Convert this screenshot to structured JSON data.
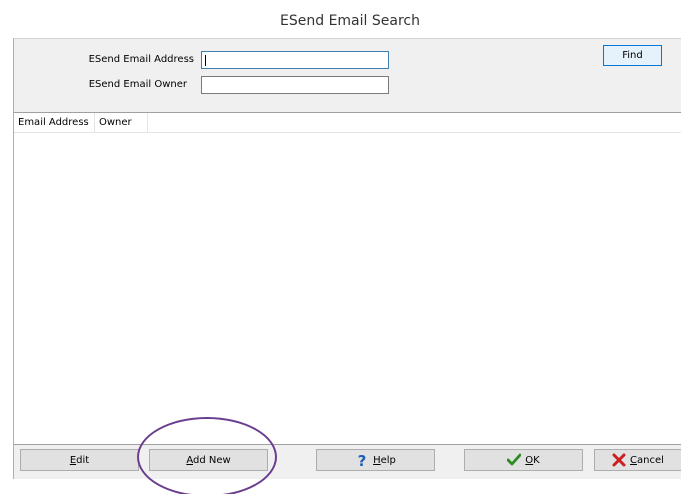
{
  "window": {
    "title": "ESend Email Search"
  },
  "search": {
    "address_label": "ESend Email Address",
    "address_value": "",
    "owner_label": "ESend Email Owner",
    "owner_value": "",
    "find_label": "Find"
  },
  "list": {
    "columns": [
      "Email Address",
      "Owner"
    ],
    "rows": []
  },
  "footer": {
    "edit_accel": "E",
    "edit_rest": "dit",
    "add_accel": "A",
    "add_rest": "dd New",
    "help_accel": "H",
    "help_rest": "elp",
    "ok_accel": "O",
    "ok_rest": "K",
    "cancel_accel": "C",
    "cancel_rest": "ancel"
  },
  "icons": {
    "help": "question-mark-icon",
    "ok": "checkmark-icon",
    "cancel": "x-mark-icon"
  },
  "colors": {
    "help_icon": "#1e5fb5",
    "ok_icon": "#2e8b22",
    "cancel_icon": "#cc1f1f",
    "annotation_circle": "#6a3d8f"
  }
}
